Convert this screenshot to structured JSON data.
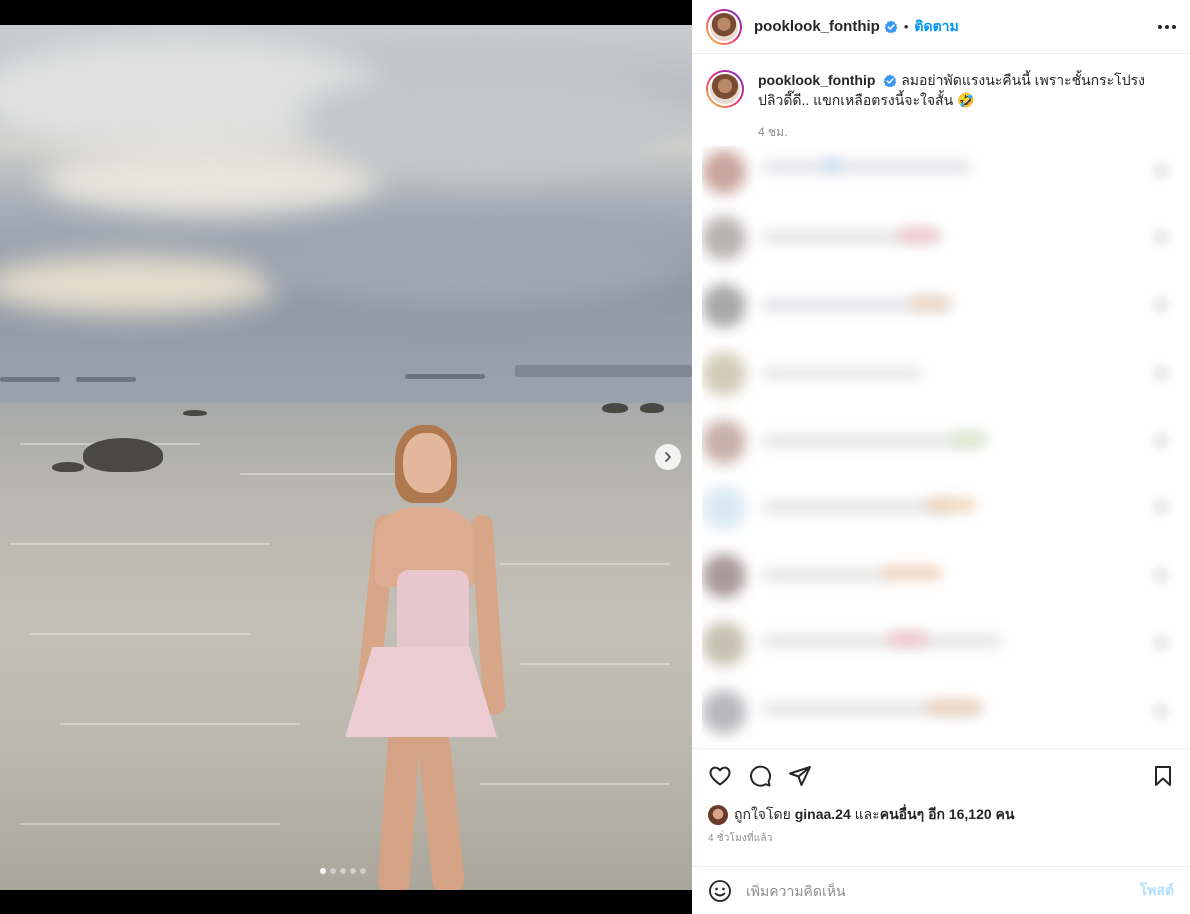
{
  "header": {
    "username": "pooklook_fonthip",
    "follow_label": "ติดตาม",
    "bullet": "•"
  },
  "caption": {
    "username": "pooklook_fonthip",
    "text": "ลมอย่าพัดแรงนะคืนนี้ เพราะชั้นกระโปรงปลิวดี๊ดี.. แขกเหลือตรงนี้จะใจสั้น 🤣",
    "time": "4 ชม."
  },
  "likes": {
    "prefix": "ถูกใจโดย",
    "user": "ginaa.24",
    "middle": "และ",
    "others": "คนอื่นๆ อีก 16,120 คน"
  },
  "posted_ago": "4 ชั่วโมงที่แล้ว",
  "comment_box": {
    "placeholder": "เพิ่มความคิดเห็น",
    "post_label": "โพสต์"
  },
  "carousel": {
    "total": 5,
    "current": 1
  },
  "icons": {
    "verified": "verified-badge-icon",
    "more": "more-options-icon",
    "next": "chevron-right-icon",
    "like": "heart-icon",
    "comment": "comment-icon",
    "share": "share-icon",
    "save": "bookmark-icon",
    "emoji": "emoji-icon"
  },
  "colors": {
    "accent": "#0095f6",
    "post_disabled": "#b2dffc",
    "text": "#262626",
    "muted": "#8e8e8e"
  }
}
